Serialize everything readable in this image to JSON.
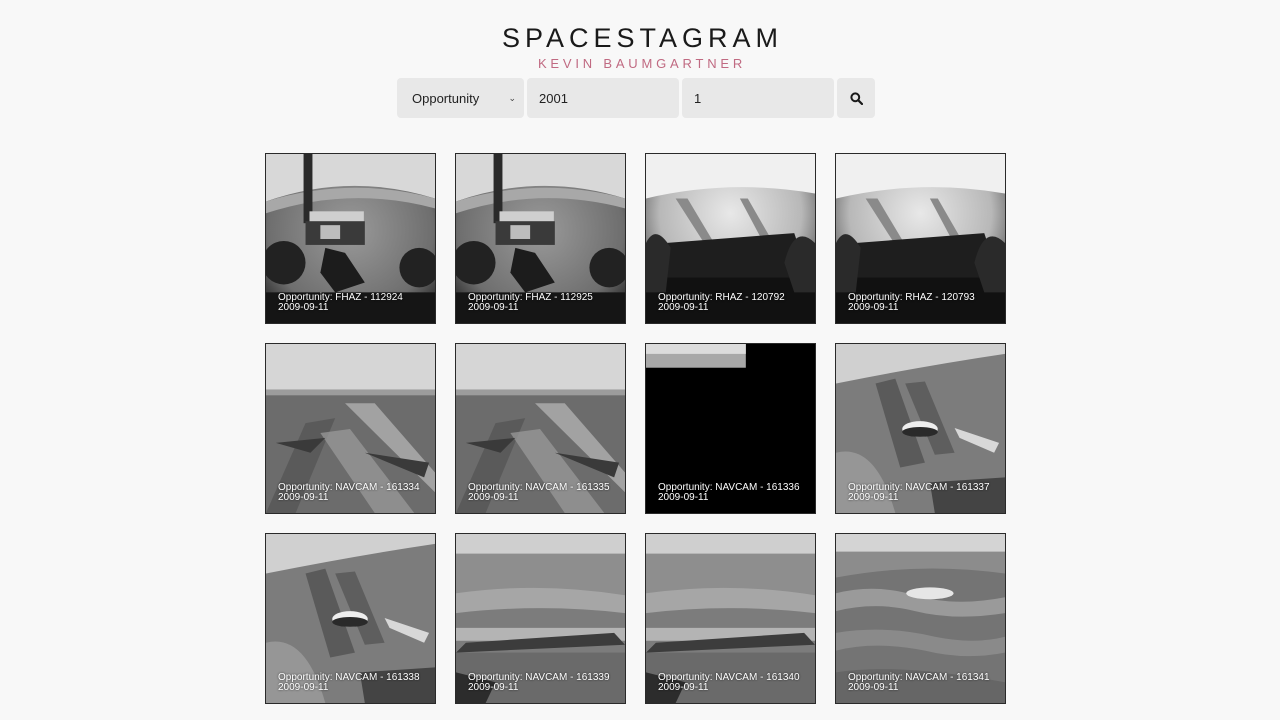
{
  "header": {
    "title": "SPACESTAGRAM",
    "subtitle": "KEVIN BAUMGARTNER"
  },
  "controls": {
    "rover_selected": "Opportunity",
    "sol_value": "2001",
    "page_value": "1",
    "search_icon": "search-icon"
  },
  "colors": {
    "subtitle_accent": "#c06a82",
    "background": "#f8f8f8",
    "control_bg": "#e8e8e8"
  },
  "photos": [
    {
      "label": "Opportunity: FHAZ - 112924",
      "date": "2009-09-11",
      "scene": "fhaz-arm"
    },
    {
      "label": "Opportunity: FHAZ - 112925",
      "date": "2009-09-11",
      "scene": "fhaz-arm"
    },
    {
      "label": "Opportunity: RHAZ - 120792",
      "date": "2009-09-11",
      "scene": "rhaz"
    },
    {
      "label": "Opportunity: RHAZ - 120793",
      "date": "2009-09-11",
      "scene": "rhaz"
    },
    {
      "label": "Opportunity: NAVCAM - 161334",
      "date": "2009-09-11",
      "scene": "navcam-tracks"
    },
    {
      "label": "Opportunity: NAVCAM - 161335",
      "date": "2009-09-11",
      "scene": "navcam-tracks"
    },
    {
      "label": "Opportunity: NAVCAM - 161336",
      "date": "2009-09-11",
      "scene": "navcam-black"
    },
    {
      "label": "Opportunity: NAVCAM - 161337",
      "date": "2009-09-11",
      "scene": "navcam-rock"
    },
    {
      "label": "Opportunity: NAVCAM - 161338",
      "date": "2009-09-11",
      "scene": "navcam-rock"
    },
    {
      "label": "Opportunity: NAVCAM - 161339",
      "date": "2009-09-11",
      "scene": "navcam-dunes"
    },
    {
      "label": "Opportunity: NAVCAM - 161340",
      "date": "2009-09-11",
      "scene": "navcam-dunes"
    },
    {
      "label": "Opportunity: NAVCAM - 161341",
      "date": "2009-09-11",
      "scene": "navcam-ripples"
    }
  ]
}
